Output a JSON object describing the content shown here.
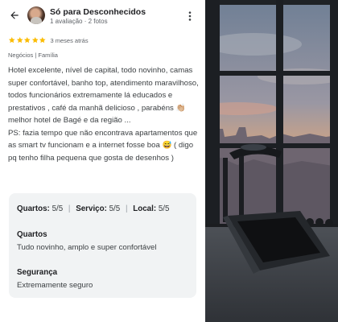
{
  "header": {
    "author_name": "Só para Desconhecidos",
    "author_meta": "1 avaliação · 2 fotos"
  },
  "review": {
    "rating": 5,
    "time_ago": "3 meses atrás",
    "trip_tags": "Negócios  |  Família",
    "text_p1": "Hotel excelente, nível de capital, todo novinho, camas super confortável, banho top, atendimento maravilhoso, todos funcionários extremamente lá educados e prestativos , café da manhã delicioso , parabéns 👏🏼 melhor hotel de Bagé e da região ...",
    "text_p2": "PS: fazia tempo que não encontrava apartamentos que as smart tv funcionam e a internet fosse boa 😅 ( digo pq tenho filha pequena que gosta de desenhos )"
  },
  "attributes": {
    "rooms_label": "Quartos:",
    "rooms_value": "5/5",
    "service_label": "Serviço:",
    "service_value": "5/5",
    "location_label": "Local:",
    "location_value": "5/5",
    "rooms_title": "Quartos",
    "rooms_comment": "Tudo novinho, amplo e super confortável",
    "safety_title": "Segurança",
    "safety_comment": "Extremamente seguro"
  },
  "colors": {
    "star": "#fbbc04",
    "card_bg": "#f1f3f4"
  },
  "icons": [
    "back-arrow-icon",
    "more-vert-icon",
    "star-icon"
  ],
  "photo": {
    "subject": "treadmill-by-window-at-sunset"
  }
}
